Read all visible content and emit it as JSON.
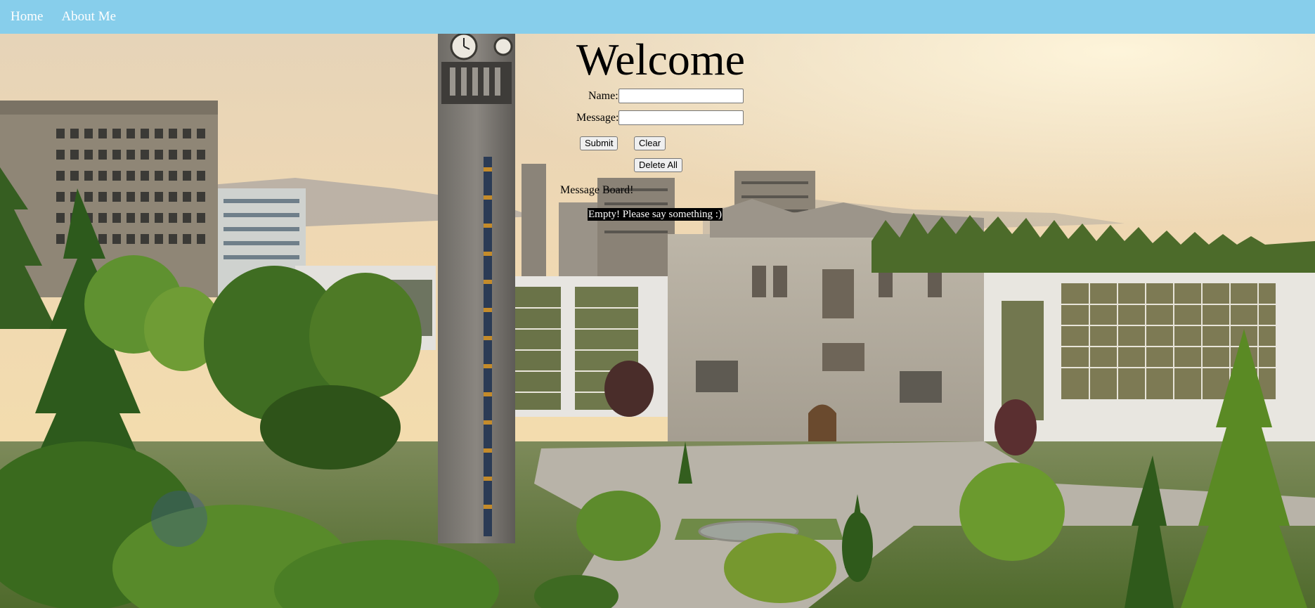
{
  "nav": {
    "home": "Home",
    "about": "About Me"
  },
  "main": {
    "title": "Welcome",
    "name_label": "Name:",
    "name_value": "",
    "message_label": "Message:",
    "message_value": "",
    "submit_label": "Submit",
    "clear_label": "Clear",
    "delete_all_label": "Delete All",
    "board_label": "Message Board!",
    "board_empty": "Empty! Please say something :)"
  },
  "colors": {
    "navbar": "#87ceeb",
    "nav_text": "#ffffff",
    "message_bg": "#000000",
    "message_text": "#ffffff"
  },
  "icons": {
    "background": "campus-photo"
  }
}
